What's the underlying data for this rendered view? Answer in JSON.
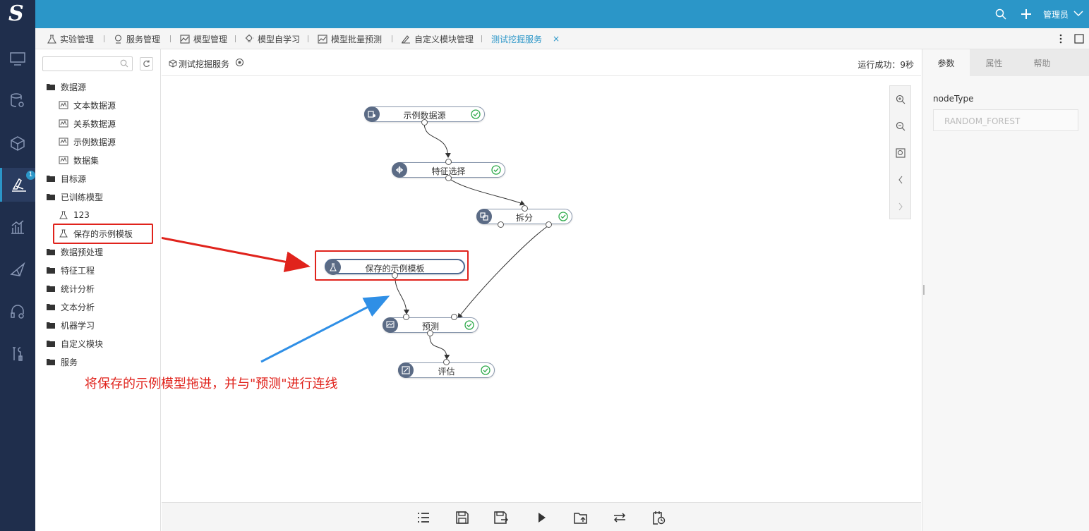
{
  "topbar": {
    "logo_text": "S",
    "admin": "管理员"
  },
  "rail": {
    "items": [
      "monitor-icon",
      "database-gear-icon",
      "cube-icon",
      "flask-icon",
      "bar-chart-icon",
      "send-icon",
      "headset-icon",
      "tools-icon"
    ],
    "active_badge": "1"
  },
  "tabs": [
    {
      "label": "实验管理",
      "icon": "flask-icon"
    },
    {
      "label": "服务管理",
      "icon": "service-icon"
    },
    {
      "label": "模型管理",
      "icon": "model-icon"
    },
    {
      "label": "模型自学习",
      "icon": "bulb-icon"
    },
    {
      "label": "模型批量预测",
      "icon": "chart-icon"
    },
    {
      "label": "自定义模块管理",
      "icon": "edit-icon"
    },
    {
      "label": "测试挖掘服务",
      "icon": "",
      "active": true
    }
  ],
  "tree": {
    "search_placeholder": "",
    "items": [
      {
        "label": "数据源",
        "type": "folder"
      },
      {
        "label": "文本数据源",
        "type": "child"
      },
      {
        "label": "关系数据源",
        "type": "child"
      },
      {
        "label": "示例数据源",
        "type": "child"
      },
      {
        "label": "数据集",
        "type": "child"
      },
      {
        "label": "目标源",
        "type": "folder"
      },
      {
        "label": "已训练模型",
        "type": "folder"
      },
      {
        "label": "123",
        "type": "child"
      },
      {
        "label": "保存的示例模板",
        "type": "child"
      },
      {
        "label": "数据预处理",
        "type": "folder"
      },
      {
        "label": "特征工程",
        "type": "folder"
      },
      {
        "label": "统计分析",
        "type": "folder"
      },
      {
        "label": "文本分析",
        "type": "folder"
      },
      {
        "label": "机器学习",
        "type": "folder"
      },
      {
        "label": "自定义模块",
        "type": "folder"
      },
      {
        "label": "服务",
        "type": "folder"
      }
    ]
  },
  "canvas": {
    "title": "测试挖掘服务",
    "status": "运行成功：9秒",
    "nodes": [
      {
        "label": "示例数据源",
        "done": true
      },
      {
        "label": "特征选择",
        "done": true
      },
      {
        "label": "拆分",
        "done": true
      },
      {
        "label": "保存的示例模板",
        "done": false
      },
      {
        "label": "预测",
        "done": true
      },
      {
        "label": "评估",
        "done": true
      }
    ],
    "annotation": "将保存的示例模型拖进，并与\"预测\"进行连线",
    "colors": {
      "highlight": "#e0231c",
      "arrow_blue": "#2f8fe6",
      "accent": "#2b96c8"
    }
  },
  "bottom_toolbar": [
    "list-icon",
    "save-icon",
    "save-as-icon",
    "run-icon",
    "export-icon",
    "swap-icon",
    "schedule-icon"
  ],
  "right_panel": {
    "tabs": [
      "参数",
      "属性",
      "帮助"
    ],
    "field_label": "nodeType",
    "field_value": "RANDOM_FOREST"
  }
}
